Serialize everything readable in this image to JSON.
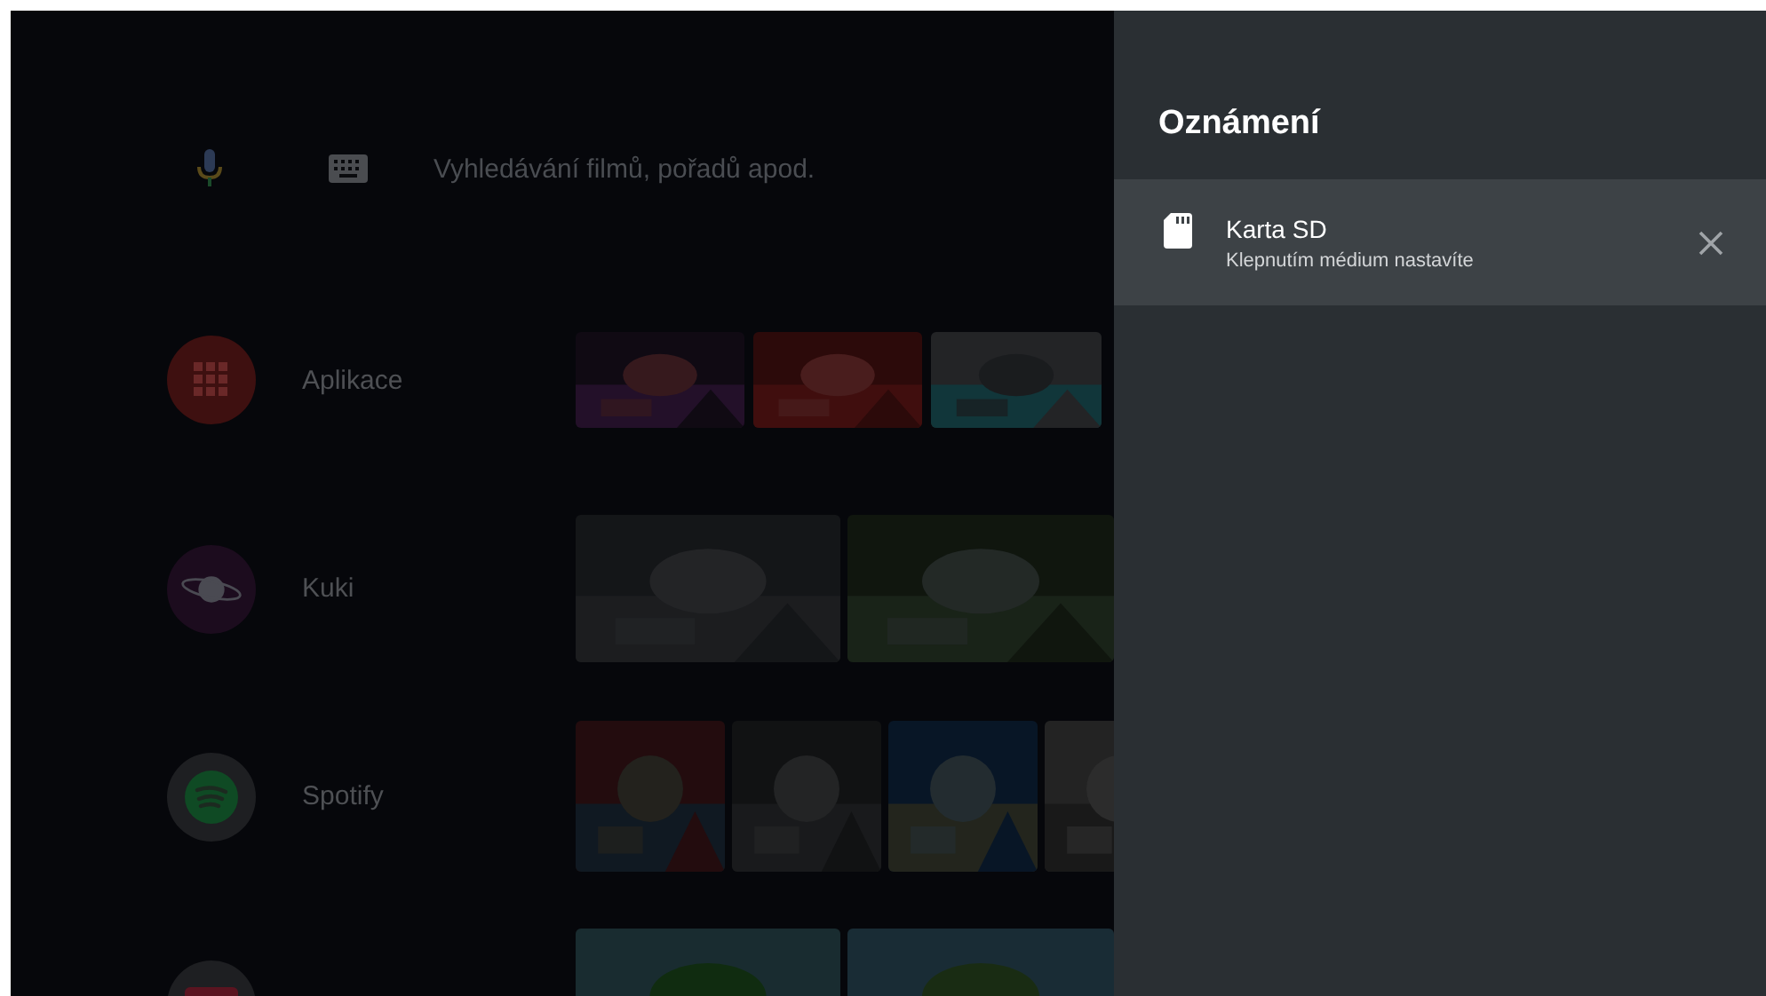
{
  "search": {
    "placeholder": "Vyhledávání filmů, pořadů apod."
  },
  "rows": [
    {
      "kind": "apps",
      "label": "Aplikace"
    },
    {
      "kind": "kuki",
      "label": "Kuki"
    },
    {
      "kind": "spotify",
      "label": "Spotify"
    },
    {
      "kind": "other"
    }
  ],
  "panel": {
    "title": "Oznámení",
    "notifications": [
      {
        "title": "Karta SD",
        "text": "Klepnutím médium nastavíte",
        "selected": true
      }
    ]
  }
}
